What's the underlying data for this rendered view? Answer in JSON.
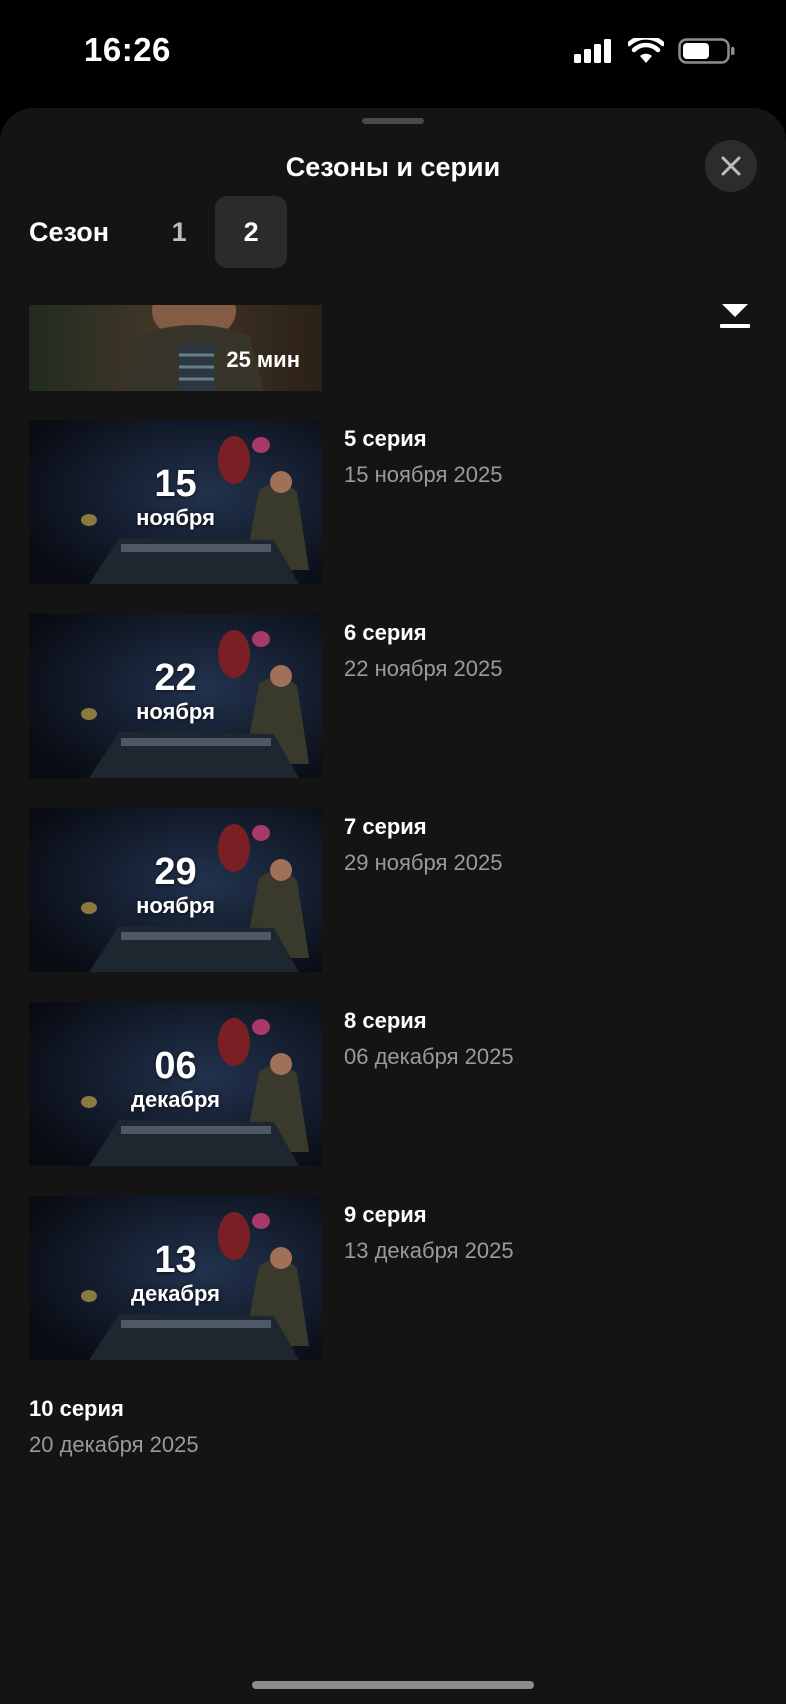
{
  "status_bar": {
    "time": "16:26"
  },
  "sheet": {
    "title": "Сезоны и серии"
  },
  "season": {
    "label": "Сезон",
    "tabs": [
      "1",
      "2"
    ],
    "selected": "2"
  },
  "partial_episode": {
    "duration": "25 мин"
  },
  "episodes": [
    {
      "title": "5 серия",
      "date": "15 ноября 2025",
      "thumb_day": "15",
      "thumb_month": "ноября"
    },
    {
      "title": "6 серия",
      "date": "22 ноября 2025",
      "thumb_day": "22",
      "thumb_month": "ноября"
    },
    {
      "title": "7 серия",
      "date": "29 ноября 2025",
      "thumb_day": "29",
      "thumb_month": "ноября"
    },
    {
      "title": "8 серия",
      "date": "06 декабря 2025",
      "thumb_day": "06",
      "thumb_month": "декабря"
    },
    {
      "title": "9 серия",
      "date": "13 декабря 2025",
      "thumb_day": "13",
      "thumb_month": "декабря"
    }
  ],
  "last_episode": {
    "title": "10 серия",
    "date": "20 декабря 2025"
  }
}
